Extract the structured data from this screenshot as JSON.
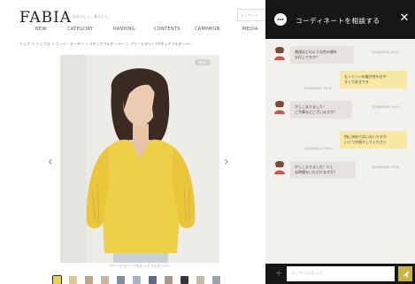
{
  "header": {
    "logo": "FABIA",
    "tagline": "自分らしく、私らしく。",
    "search_placeholder": "キーワード",
    "nav": [
      "NEW",
      "CATEGORY",
      "RANKING",
      "CONTENTS",
      "CAMPAIGN",
      "MEDIA"
    ]
  },
  "breadcrumb": "トップ ＞ トップス ＞ ニット・セーター ＞ Vネックプルオーバー ＞ プリーツスリーブVネックプルオーバー",
  "product": {
    "badge": "拡大",
    "caption": "プリーツスリーブVネックプルオーバー",
    "colors": {
      "sweater": "#efcf46",
      "background": "#eeece8"
    },
    "thumbnail_count": 11
  },
  "chat": {
    "title": "コーディネートを相談する",
    "input_placeholder": "メッセージを入力",
    "messages": [
      {
        "from": "staff",
        "text": "普段はどのような色の服を\nお召しですか？",
        "time": "2018/06/22 19:12"
      },
      {
        "from": "user",
        "text": "モノトーンの服が合わせや\nすくて好きです",
        "time": "2018/06/22 19:12"
      },
      {
        "from": "staff",
        "text": "かしこまりました！\nご予算などございますか？",
        "time": "2018/06/22 19:12"
      },
      {
        "from": "user",
        "text": "特に決めてはいないですが\nいくつか紹介してください",
        "time": "2018/06/22 19:12"
      },
      {
        "from": "staff",
        "text": "かしこまりました！少し\nお時間をいただけますか？",
        "time": "2018/06/22 19:12"
      }
    ]
  },
  "theme": {
    "chat_header_bg": "#161616",
    "user_bubble": "#f7e8a4",
    "staff_bubble": "#e6e3de",
    "send_button": "#c8b44a"
  }
}
